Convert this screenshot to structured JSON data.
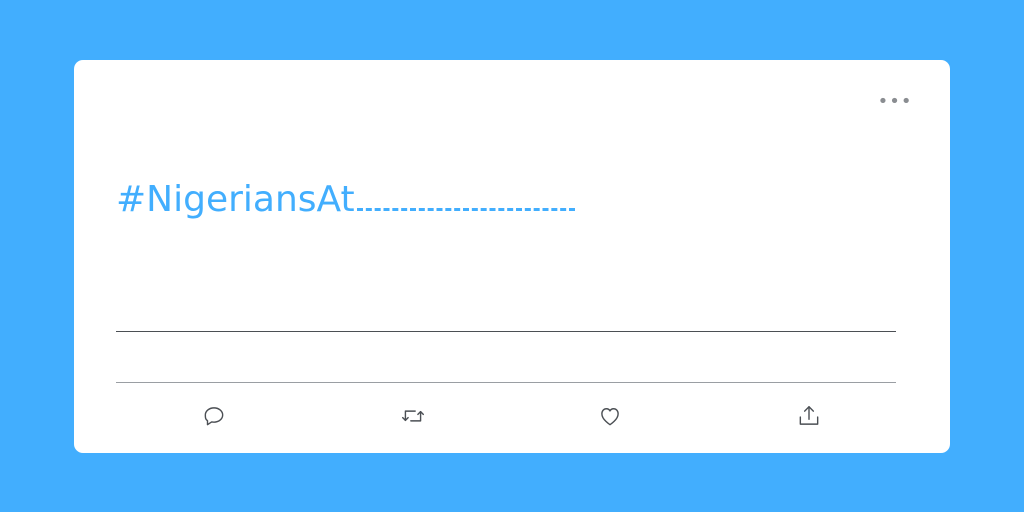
{
  "tweet": {
    "more_label": "•••",
    "hashtag_text": "#NigeriansAt"
  },
  "actions": {
    "reply_icon": "reply-icon",
    "retweet_icon": "retweet-icon",
    "like_icon": "heart-icon",
    "share_icon": "share-icon"
  },
  "colors": {
    "background": "#42aefe",
    "card": "#ffffff",
    "hashtag": "#42aefe",
    "icon": "#4b4f54"
  }
}
